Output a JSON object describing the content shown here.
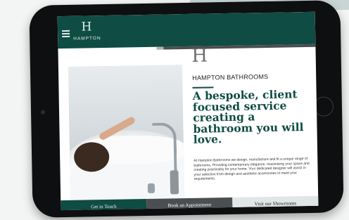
{
  "brand": {
    "mark": "H",
    "name": "HAMPTON"
  },
  "hero": {
    "eyebrow": "HAMPTON BATHROOMS",
    "headline": "A bespoke, client focused service creating a bathroom you will love.",
    "body": "At Hampton Bathrooms we design, manufacture and fit a unique range of bathrooms. Providing contemporary elegance, maximising your space and creating practicality for your home. Your dedicated designer will assist in your selection from design and aesthetic accessories to meet your requirements."
  },
  "cta": {
    "get_in_touch": "Get in Touch",
    "book": "Book an Appointment",
    "showroom": "Visit our Showrooms"
  },
  "colors": {
    "brand_green": "#0f4c43",
    "dark_grey": "#4b4f52",
    "light_teal": "#dfe6e5"
  },
  "icons": {
    "menu": "hamburger-icon",
    "logo": "hampton-logo-icon"
  }
}
